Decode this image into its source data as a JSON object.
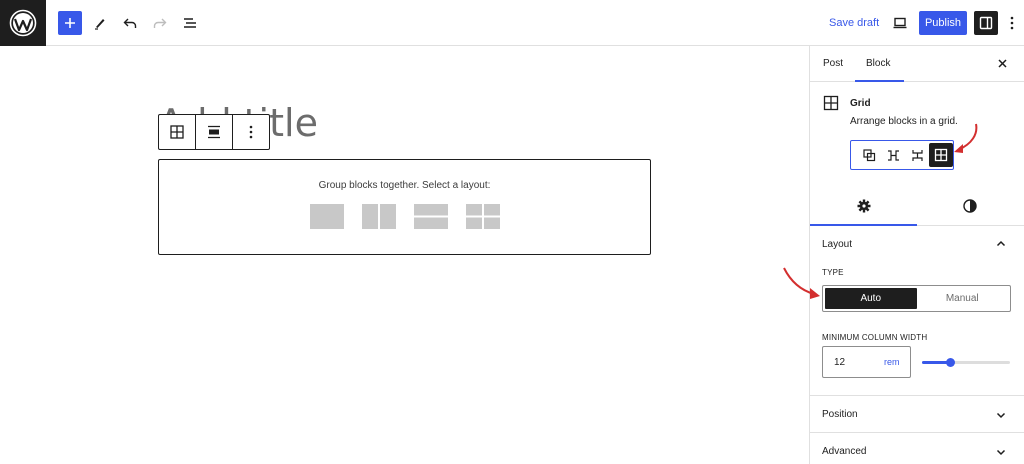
{
  "topbar": {
    "logo_icon": "wordpress-logo-icon",
    "icons": [
      "plus-icon",
      "pencil-icon",
      "undo-icon",
      "redo-icon",
      "list-view-icon",
      "desktop-preview-icon",
      "settings-sidebar-icon",
      "more-vertical-icon"
    ],
    "save_draft": "Save draft",
    "publish": "Publish",
    "accent": "#3858e9"
  },
  "canvas": {
    "title_placeholder": "Add title",
    "block_toolbar": {
      "icons": [
        "grid-icon",
        "justify-icon",
        "more-vertical-icon"
      ]
    },
    "placeholder": {
      "label": "Group blocks together. Select a layout:",
      "layouts": [
        "group",
        "row",
        "stack",
        "grid"
      ]
    }
  },
  "sidebar": {
    "tabs": [
      "Post",
      "Block"
    ],
    "active_tab": "Block",
    "block": {
      "name": "Grid",
      "description": "Arrange blocks in a grid.",
      "variations": [
        "group-icon",
        "row-icon",
        "stack-icon",
        "grid-icon"
      ],
      "active_variation": "grid-icon"
    },
    "sub_tabs": [
      "settings-gear-icon",
      "styles-half-circle-icon"
    ],
    "layout": {
      "title": "Layout",
      "type_label": "TYPE",
      "type_options": [
        "Auto",
        "Manual"
      ],
      "selected_type": "Auto",
      "min_width_label": "MINIMUM COLUMN WIDTH",
      "min_width_value": "12",
      "min_width_unit": "rem",
      "slider_fraction": 0.32
    },
    "position_title": "Position",
    "advanced_title": "Advanced"
  },
  "annotation_color": "#d32f2f"
}
